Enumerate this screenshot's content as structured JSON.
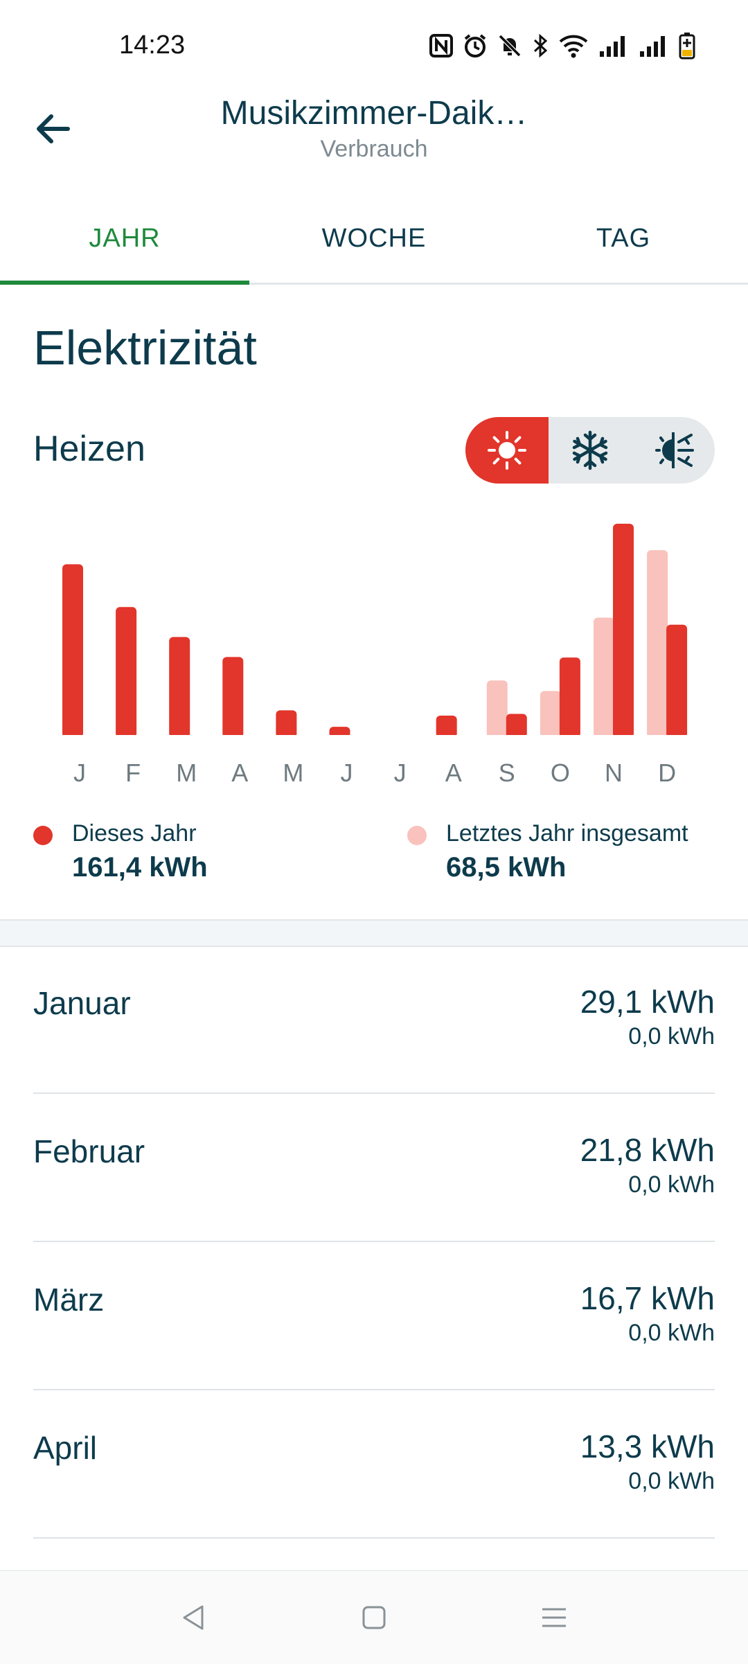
{
  "status_bar": {
    "time": "14:23",
    "icons": [
      "nfc-icon",
      "alarm-icon",
      "mute-icon",
      "bluetooth-icon",
      "wifi-icon",
      "signal-icon",
      "signal-icon",
      "battery-icon"
    ]
  },
  "header": {
    "title": "Musikzimmer-Daik…",
    "subtitle": "Verbrauch",
    "back_icon": "arrow-left-icon"
  },
  "tabs": [
    {
      "label": "JAHR",
      "active": true
    },
    {
      "label": "WOCHE",
      "active": false
    },
    {
      "label": "TAG",
      "active": false
    }
  ],
  "section": {
    "title": "Elektrizität",
    "mode_label": "Heizen"
  },
  "mode_toggle": [
    {
      "icon": "sun-heating-icon",
      "active": true
    },
    {
      "icon": "snowflake-cooling-icon",
      "active": false
    },
    {
      "icon": "heat-cool-auto-icon",
      "active": false
    }
  ],
  "colors": {
    "this_year": "#e2352b",
    "last_year": "#f9c2bd",
    "accent": "#1e8a3c",
    "text": "#0d3b4c"
  },
  "chart_data": {
    "type": "bar",
    "categories": [
      "J",
      "F",
      "M",
      "A",
      "M",
      "J",
      "J",
      "A",
      "S",
      "O",
      "N",
      "D"
    ],
    "series": [
      {
        "name": "Dieses Jahr",
        "values": [
          29.1,
          21.8,
          16.7,
          13.3,
          4.2,
          1.4,
          0,
          3.3,
          3.6,
          13.2,
          36.0,
          18.8
        ]
      },
      {
        "name": "Letztes Jahr",
        "values": [
          0,
          0,
          0,
          0,
          0,
          0,
          0,
          0,
          9.3,
          7.5,
          20.0,
          31.5
        ]
      }
    ],
    "grid": false,
    "legend": "bottom"
  },
  "legend": {
    "this_year": {
      "label": "Dieses Jahr",
      "value": "161,4 kWh"
    },
    "last_year": {
      "label": "Letztes Jahr insgesamt",
      "value": "68,5 kWh"
    }
  },
  "months": [
    {
      "name": "Januar",
      "value": "29,1 kWh",
      "prev": "0,0 kWh"
    },
    {
      "name": "Februar",
      "value": "21,8 kWh",
      "prev": "0,0 kWh"
    },
    {
      "name": "März",
      "value": "16,7 kWh",
      "prev": "0,0 kWh"
    },
    {
      "name": "April",
      "value": "13,3 kWh",
      "prev": "0,0 kWh"
    }
  ],
  "nav_bar": [
    "back-triangle-icon",
    "home-square-icon",
    "menu-lines-icon"
  ]
}
